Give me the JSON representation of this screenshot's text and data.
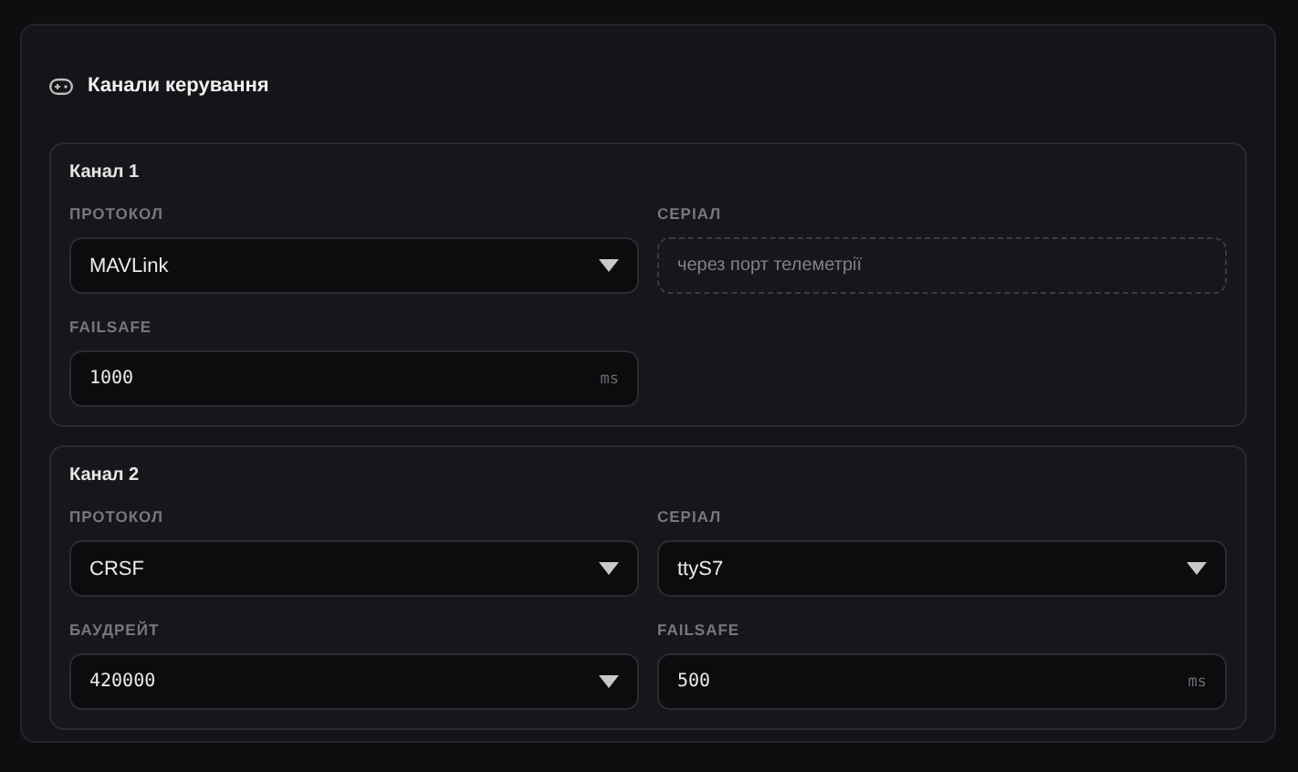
{
  "panel": {
    "title": "Канали керування"
  },
  "channels": [
    {
      "title": "Канал 1",
      "fields": [
        {
          "label": "ПРОТОКОЛ",
          "kind": "select",
          "value": "MAVLink",
          "monospace": false
        },
        {
          "label": "СЕРІАЛ",
          "kind": "readonly",
          "placeholder": "через порт телеметрії"
        },
        {
          "label": "FAILSAFE",
          "kind": "number",
          "value": "1000",
          "unit": "ms",
          "monospace": true
        }
      ]
    },
    {
      "title": "Канал 2",
      "fields": [
        {
          "label": "ПРОТОКОЛ",
          "kind": "select",
          "value": "CRSF",
          "monospace": false
        },
        {
          "label": "СЕРІАЛ",
          "kind": "select",
          "value": "ttyS7",
          "monospace": false
        },
        {
          "label": "БАУДРЕЙТ",
          "kind": "select",
          "value": "420000",
          "monospace": true
        },
        {
          "label": "FAILSAFE",
          "kind": "number",
          "value": "500",
          "unit": "ms",
          "monospace": true
        }
      ]
    }
  ]
}
